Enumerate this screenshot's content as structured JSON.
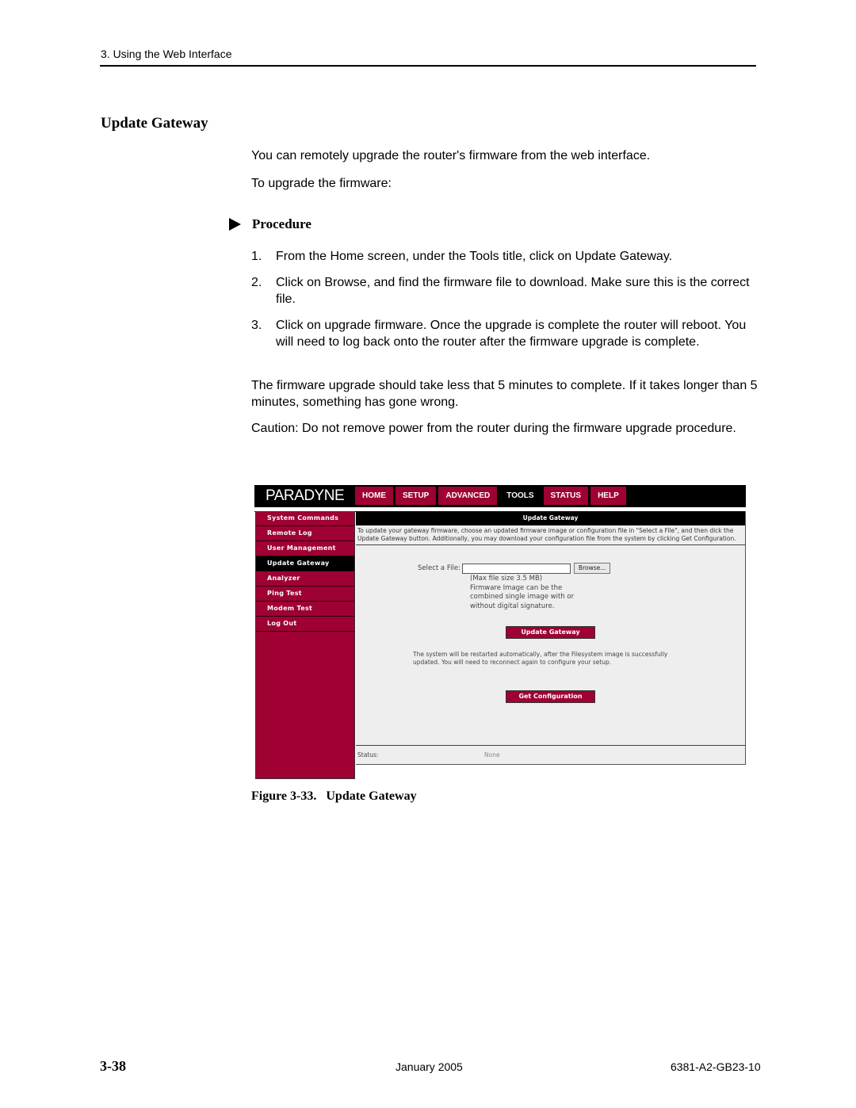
{
  "header": {
    "running_head": "3. Using the Web Interface"
  },
  "section": {
    "title": "Update Gateway"
  },
  "intro": {
    "p1": "You can remotely upgrade the router's firmware from the web interface.",
    "p2": "To upgrade the firmware:"
  },
  "procedure": {
    "icon": "triangle-right-icon",
    "title": "Procedure",
    "steps": [
      {
        "num": "1.",
        "text": "From the Home screen, under the Tools title, click on Update Gateway."
      },
      {
        "num": "2.",
        "text": "Click on Browse, and find the firmware file to download. Make sure this is the correct file."
      },
      {
        "num": "3.",
        "text": "Click on upgrade firmware. Once the upgrade is complete the router will reboot. You will need to log back onto the router after the firmware upgrade is complete."
      }
    ]
  },
  "notes": {
    "p3": "The firmware upgrade should take less that 5 minutes to complete. If it takes longer than 5 minutes, something has gone wrong.",
    "p4": "Caution: Do not remove power from the router during the firmware upgrade procedure."
  },
  "screenshot": {
    "logo": "PARADYNE",
    "nav_tabs": [
      {
        "label": "HOME",
        "active": false
      },
      {
        "label": "SETUP",
        "active": false
      },
      {
        "label": "ADVANCED",
        "active": false
      },
      {
        "label": "TOOLS",
        "active": true
      },
      {
        "label": "STATUS",
        "active": false
      },
      {
        "label": "HELP",
        "active": false
      }
    ],
    "sidebar": [
      {
        "label": "System Commands",
        "active": false
      },
      {
        "label": "Remote Log",
        "active": false
      },
      {
        "label": "User Management",
        "active": false
      },
      {
        "label": "Update Gateway",
        "active": true
      },
      {
        "label": "Analyzer",
        "active": false
      },
      {
        "label": "Ping Test",
        "active": false
      },
      {
        "label": "Modem Test",
        "active": false
      },
      {
        "label": "Log Out",
        "active": false
      }
    ],
    "content_title": "Update Gateway",
    "description": "To update your gateway firmware, choose an updated firmware image or configuration file in \"Select a File\", and then dick the Update Gateway button. Additionally, you may download your configuration file from the system by clicking Get Configuration.",
    "file_label": "Select a File:",
    "file_value": "",
    "browse_label": "Browse...",
    "file_notes": [
      "(Max file size 3.5 MB)",
      "Firmware Image can be the",
      "combined single image with or",
      "without digital signature."
    ],
    "update_button": "Update Gateway",
    "restart_note": "The system will be restarted automatically, after the Filesystem image is successfully updated. You will need to reconnect again to configure your setup.",
    "get_config_button": "Get Configuration",
    "status_label": "Status:",
    "status_value": "None",
    "colors": {
      "brand": "#9e0132",
      "bar": "#000000",
      "panel": "#eeeeee"
    }
  },
  "figure": {
    "caption": "Figure 3-33.   Update Gateway"
  },
  "footer": {
    "page": "3-38",
    "date": "January 2005",
    "doc_number": "6381-A2-GB23-10"
  }
}
